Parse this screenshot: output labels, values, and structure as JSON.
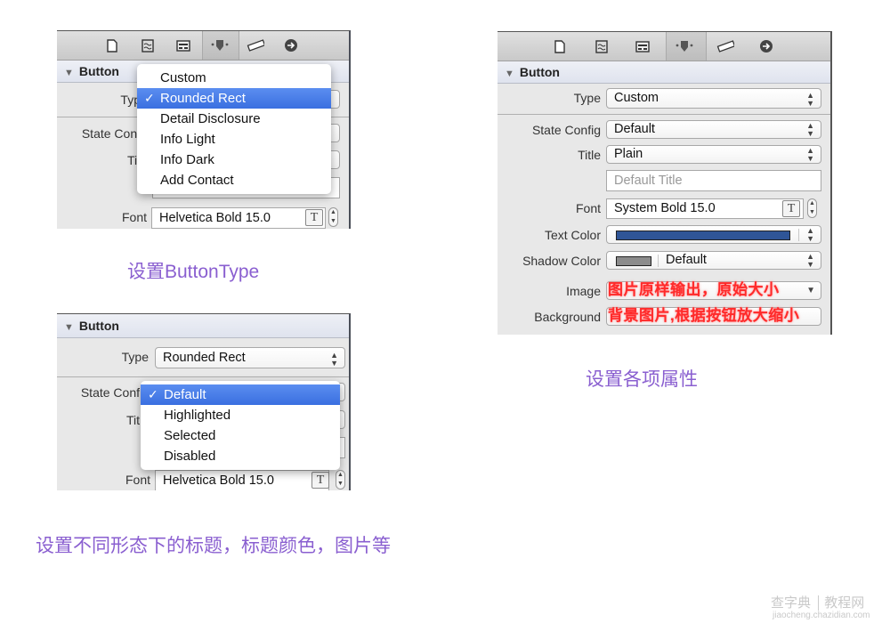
{
  "toolbar_icons": [
    "file-inspector-icon",
    "quick-help-icon",
    "identity-inspector-icon",
    "attributes-inspector-icon",
    "size-inspector-icon",
    "connections-inspector-icon"
  ],
  "panel_type_menu": {
    "section_title": "Button",
    "type_label": "Typ",
    "state_config_label": "State Conf",
    "title_label": "Tit",
    "font_label": "Font",
    "font_value": "Helvetica Bold 15.0",
    "type_menu": {
      "items": [
        "Custom",
        "Rounded Rect",
        "Detail Disclosure",
        "Info Light",
        "Info Dark",
        "Add Contact"
      ],
      "selected": "Rounded Rect",
      "check": "✓"
    }
  },
  "caption_button_type": "设置ButtonType",
  "panel_state_menu": {
    "section_title": "Button",
    "type_label": "Type",
    "type_value": "Rounded Rect",
    "state_config_label": "State Conf",
    "title_label": "Tit",
    "font_label": "Font",
    "font_value": "Helvetica Bold 15.0",
    "state_menu": {
      "items": [
        "Default",
        "Highlighted",
        "Selected",
        "Disabled"
      ],
      "selected": "Default",
      "check": "✓"
    }
  },
  "caption_states": "设置不同形态下的标题，标题颜色，图片等",
  "panel_attributes": {
    "section_title": "Button",
    "type_label": "Type",
    "type_value": "Custom",
    "state_config_label": "State Config",
    "state_config_value": "Default",
    "title_label": "Title",
    "title_value": "Plain",
    "title_text_placeholder": "Default Title",
    "font_label": "Font",
    "font_value": "System Bold 15.0",
    "text_color_label": "Text Color",
    "text_color": "#2f5597",
    "shadow_color_label": "Shadow Color",
    "shadow_color": "#8c8c8c",
    "shadow_color_value": "Default",
    "image_label": "Image",
    "image_note": "图片原样输出，原始大小",
    "background_label": "Background",
    "background_note": "背景图片,根据按钮放大缩小"
  },
  "caption_attributes": "设置各项属性",
  "watermark": {
    "brand": "查字典",
    "sub": "教程网",
    "url": "jiaocheng.chazidian.com"
  },
  "colors": {
    "caption": "#8a5fd0",
    "menu_selected": "#3a6fe0",
    "note_red": "#ff2a2a"
  }
}
